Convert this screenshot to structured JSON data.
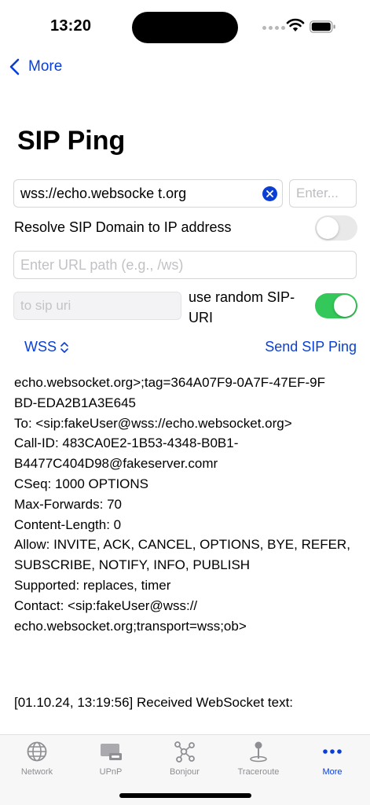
{
  "status_bar": {
    "time": "13:20"
  },
  "nav": {
    "back_label": "More"
  },
  "page": {
    "title": "SIP Ping"
  },
  "form": {
    "url_value": "wss://echo.websocke t.org",
    "port_placeholder": "Enter...",
    "resolve_label": "Resolve SIP Domain to IP address",
    "resolve_enabled": false,
    "path_placeholder": "Enter URL path (e.g., /ws)",
    "sip_uri_placeholder": "to sip uri",
    "random_label": "use random SIP-URI",
    "random_enabled": true,
    "protocol": "WSS",
    "send_label": "Send SIP Ping"
  },
  "log": {
    "lines": [
      "echo.websocket.org>;tag=364A07F9-0A7F-47EF-9F",
      "BD-EDA2B1A3E645",
      "To: <sip:fakeUser@wss://echo.websocket.org>",
      "Call-ID: 483CA0E2-1B53-4348-B0B1-",
      "B4477C404D98@fakeserver.comr",
      "CSeq: 1000 OPTIONS",
      "Max-Forwards: 70",
      "Content-Length: 0",
      "Allow: INVITE, ACK, CANCEL, OPTIONS, BYE, REFER,",
      "SUBSCRIBE, NOTIFY, INFO, PUBLISH",
      "Supported: replaces, timer",
      "Contact: <sip:fakeUser@wss://",
      "echo.websocket.org;transport=wss;ob>"
    ],
    "received": "[01.10.24, 13:19:56] Received WebSocket text:"
  },
  "tabs": [
    {
      "label": "Network",
      "icon": "globe-icon",
      "active": false
    },
    {
      "label": "UPnP",
      "icon": "upnp-device-icon",
      "active": false
    },
    {
      "label": "Bonjour",
      "icon": "bonjour-network-icon",
      "active": false
    },
    {
      "label": "Traceroute",
      "icon": "traceroute-pin-icon",
      "active": false
    },
    {
      "label": "More",
      "icon": "more-ellipsis-icon",
      "active": true
    }
  ],
  "colors": {
    "accent": "#0a3fd6",
    "toggle_on": "#34c759",
    "tab_inactive": "#8e8e93"
  }
}
